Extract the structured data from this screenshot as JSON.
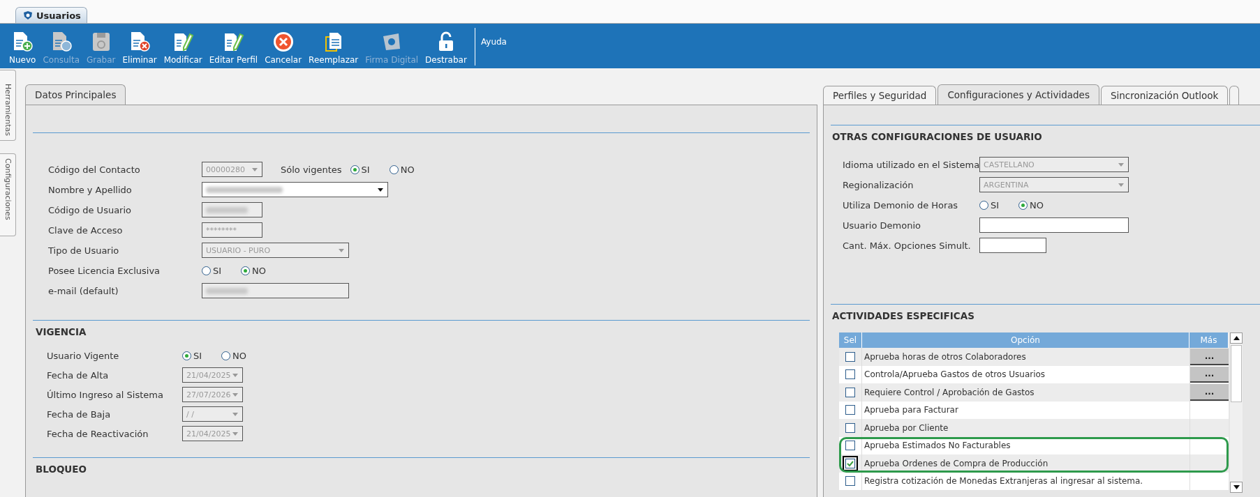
{
  "window_tabs": [
    {
      "label": "Usuarios",
      "selected": true
    }
  ],
  "toolbar": {
    "buttons": [
      {
        "label": "Nuevo",
        "kind": "new",
        "disabled": false
      },
      {
        "label": "Consulta",
        "kind": "query",
        "disabled": true
      },
      {
        "label": "Grabar",
        "kind": "save",
        "disabled": true
      },
      {
        "label": "Eliminar",
        "kind": "delete",
        "disabled": false
      },
      {
        "label": "Modificar",
        "kind": "edit",
        "disabled": false
      },
      {
        "label": "Editar Perfil",
        "kind": "edit",
        "disabled": false
      },
      {
        "label": "Cancelar",
        "kind": "cancel",
        "disabled": false
      },
      {
        "label": "Reemplazar",
        "kind": "replace",
        "disabled": false
      },
      {
        "label": "Firma Digital",
        "kind": "sign",
        "disabled": true
      },
      {
        "label": "Destrabar",
        "kind": "unlock",
        "disabled": false
      }
    ],
    "help": "Ayuda"
  },
  "side_tabs": [
    {
      "label": "Herramientas"
    },
    {
      "label": "Configuraciones"
    }
  ],
  "left_panel": {
    "tabs": [
      {
        "label": "Datos Principales",
        "selected": true
      }
    ],
    "main_fields": [
      {
        "label": "Código del Contacto",
        "kind": "combo",
        "value": "00000280",
        "disabled": true,
        "side_radio": {
          "label": "Sólo vigentes",
          "options": [
            {
              "label": "SI",
              "selected": true
            },
            {
              "label": "NO",
              "selected": false
            }
          ]
        }
      },
      {
        "label": "Nombre y Apellido",
        "kind": "combo",
        "redacted": true,
        "disabled": false
      },
      {
        "label": "Código de Usuario",
        "kind": "text",
        "redacted": true,
        "disabled": true
      },
      {
        "label": "Clave de Acceso",
        "kind": "text",
        "value": "********",
        "disabled": true
      },
      {
        "label": "Tipo de Usuario",
        "kind": "combo",
        "value": "USUARIO - PURO",
        "disabled": true
      },
      {
        "label": "Posee Licencia Exclusiva",
        "kind": "radio",
        "options": [
          {
            "label": "SI",
            "selected": false
          },
          {
            "label": "NO",
            "selected": true
          }
        ]
      },
      {
        "label": "e-mail (default)",
        "kind": "text",
        "redacted": true,
        "disabled": true
      }
    ],
    "vigencia": {
      "title": "VIGENCIA",
      "fields": [
        {
          "label": "Usuario Vigente",
          "kind": "radio",
          "options": [
            {
              "label": "SI",
              "selected": true
            },
            {
              "label": "NO",
              "selected": false
            }
          ]
        },
        {
          "label": "Fecha de Alta",
          "kind": "combo",
          "value": "21/04/2025",
          "disabled": true
        },
        {
          "label": "Último Ingreso al Sistema",
          "kind": "combo",
          "value": "27/07/2026",
          "disabled": true
        },
        {
          "label": "Fecha de Baja",
          "kind": "combo",
          "value": "/ /",
          "disabled": true
        },
        {
          "label": "Fecha de Reactivación",
          "kind": "combo",
          "value": "21/04/2025",
          "disabled": true
        }
      ]
    },
    "bloqueo": {
      "title": "BLOQUEO"
    }
  },
  "right_panel": {
    "tabs": [
      {
        "label": "Perfiles y Seguridad",
        "selected": false
      },
      {
        "label": "Configuraciones y Actividades",
        "selected": true
      },
      {
        "label": "Sincronización Outlook",
        "selected": false
      }
    ],
    "otras": {
      "title": "OTRAS CONFIGURACIONES DE USUARIO",
      "fields": [
        {
          "label": "Idioma utilizado en el Sistema",
          "kind": "combo",
          "value": "CASTELLANO",
          "disabled": true
        },
        {
          "label": "Regionalización",
          "kind": "combo",
          "value": "ARGENTINA",
          "disabled": true
        },
        {
          "label": "Utiliza Demonio de Horas",
          "kind": "radio",
          "options": [
            {
              "label": "SI",
              "selected": false
            },
            {
              "label": "NO",
              "selected": true
            }
          ]
        },
        {
          "label": "Usuario Demonio",
          "kind": "text",
          "disabled": false
        },
        {
          "label": "Cant. Máx. Opciones Simult.",
          "kind": "text",
          "disabled": false
        }
      ]
    },
    "actividades": {
      "title": "ACTIVIDADES ESPECIFICAS",
      "columns": [
        "Sel",
        "Opción",
        "Más"
      ],
      "rows": [
        {
          "label": "Aprueba horas de otros Colaboradores",
          "checked": false,
          "more": "...",
          "highlighted": false,
          "focused": false
        },
        {
          "label": "Controla/Aprueba Gastos de otros Usuarios",
          "checked": false,
          "more": "...",
          "highlighted": false,
          "focused": false
        },
        {
          "label": "Requiere Control / Aprobación de Gastos",
          "checked": false,
          "more": "...",
          "highlighted": false,
          "focused": false
        },
        {
          "label": "Aprueba para Facturar",
          "checked": false,
          "highlighted": false,
          "focused": false
        },
        {
          "label": "Aprueba por Cliente",
          "checked": false,
          "highlighted": false,
          "focused": false
        },
        {
          "label": "Aprueba Estimados No Facturables",
          "checked": false,
          "highlighted": true,
          "focused": false
        },
        {
          "label": "Aprueba Ordenes de Compra de Producción",
          "checked": true,
          "highlighted": true,
          "focused": true
        },
        {
          "label": "Registra cotización de Monedas Extranjeras al ingresar al sistema.",
          "checked": false,
          "highlighted": false,
          "focused": false
        }
      ]
    }
  }
}
